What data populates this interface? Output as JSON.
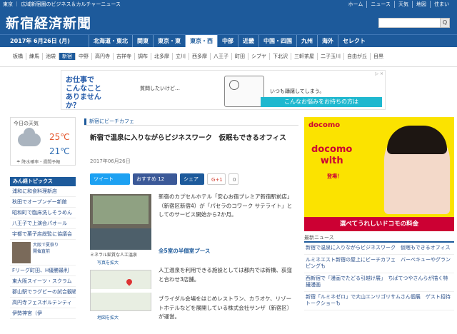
{
  "topbar": {
    "tag": "東京 ｜ 広域新宿圏のビジネス＆カルチャーニュース",
    "links": [
      "ホーム",
      "ニュース",
      "天気",
      "地図",
      "住まい"
    ]
  },
  "header": {
    "logo": "新宿経済新聞",
    "search_button": "Q"
  },
  "nav": {
    "date": "2017年 6月26日 (月)",
    "regions": [
      {
        "label": "北海道・東北",
        "active": false
      },
      {
        "label": "関東",
        "active": false
      },
      {
        "label": "東京・東",
        "active": false
      },
      {
        "label": "東京・西",
        "active": true
      },
      {
        "label": "中部",
        "active": false
      },
      {
        "label": "近畿",
        "active": false
      },
      {
        "label": "中国・四国",
        "active": false
      },
      {
        "label": "九州",
        "active": false
      },
      {
        "label": "海外",
        "active": false
      },
      {
        "label": "セレクト",
        "active": false
      }
    ]
  },
  "subnav": {
    "items": [
      {
        "label": "板橋",
        "on": false
      },
      {
        "label": "練馬",
        "on": false
      },
      {
        "label": "池袋",
        "on": false
      },
      {
        "label": "新宿",
        "on": true
      },
      {
        "label": "中野",
        "on": false
      },
      {
        "label": "高円寺",
        "on": false
      },
      {
        "label": "吉祥寺",
        "on": false
      },
      {
        "label": "調布",
        "on": false
      },
      {
        "label": "北多摩",
        "on": false
      },
      {
        "label": "立川",
        "on": false
      },
      {
        "label": "西多摩",
        "on": false
      },
      {
        "label": "八王子",
        "on": false
      },
      {
        "label": "町田",
        "on": false
      },
      {
        "label": "シブヤ",
        "on": false
      },
      {
        "label": "下北沢",
        "on": false
      },
      {
        "label": "三軒茶屋",
        "on": false
      },
      {
        "label": "二子玉川",
        "on": false
      },
      {
        "label": "自由が丘",
        "on": false
      },
      {
        "label": "目黒",
        "on": false
      }
    ]
  },
  "ad_banner": {
    "left_text": "お仕事で\nこんなこと\nありませんか？",
    "mid_text": "質問したいけど…",
    "right_text": "いつも躊躇してしまう。",
    "cta": "こんなお悩みをお持ちの方は",
    "choice": "▷ ×"
  },
  "weather": {
    "title": "今日の天気",
    "high": "25℃",
    "low": "21℃",
    "note": "☂ 降水確率・週間予報"
  },
  "topics": {
    "head": "みん経トピックス",
    "items": [
      "浦和に和食料理新店",
      "秋田でオープンデー新館",
      "昭和町で臨床洗しそうめん",
      "八王子で上演会パオール",
      "宇都で菓子店総監に協議会"
    ],
    "pic_item": "大阪で夏祭り\n開催直前",
    "items2": [
      "Fリーグ町田、H優勝最利",
      "東大阪スイーツ・スクラム",
      "郡山駅でラグビーの試合観戦",
      "高円寺フェスボルテンティ",
      "伊勢神宮（伊"
    ]
  },
  "article": {
    "category": "新宿にビーチカフェ",
    "headline": "新宿で温泉に入りながらビジネスワーク　仮眠もできるオフィス",
    "date": "2017年06月26日",
    "share": {
      "tweet": "ツイート",
      "fb": "おすすめ 12",
      "share": "シェア",
      "gplus": "G+1",
      "gcount": "0"
    },
    "caption": "ミネラル鉱質な人工温泉",
    "zoom1": "写真を拡大",
    "zoom2": "地図を拡大",
    "body1": "新宿のカプセルホテル「安心お宿プレミア新宿駅前店」（新宿区新宿4）が「パセラのコワーク サテライト」としてのサービス開始から2か月。",
    "subhead": "全5室の半個室プース",
    "body2": "人工温泉を利用できる施設としては都内では新橋、荻窪と合わせ3店舗。",
    "body3": "ブライダル会場をはじめレストラン、カラオケ、リゾートホテルなどを展開している株式会社サンザ（新宿区）が運営。"
  },
  "docomo_ad": {
    "logo": "docomo",
    "slogan": "docomo\nwith",
    "toujou": "登場！",
    "footer": "選べてうれしいドコモの料金"
  },
  "news": {
    "head": "最新ニュース",
    "items": [
      "新宿で温泉に入りながらビジネスワーク　仮眠もできるオフィス",
      "ルミネエスト新宿の屋上にビーチカフェ　バーベキューやグランピングも",
      "西新宿で「漫画でたどる引越け展」　ちばてつやさんらが描く特撮漫画",
      "新宿「ルミネゼロ」で大山エンリゴリサムさん個展　ゲスト招待トークショーも"
    ]
  }
}
